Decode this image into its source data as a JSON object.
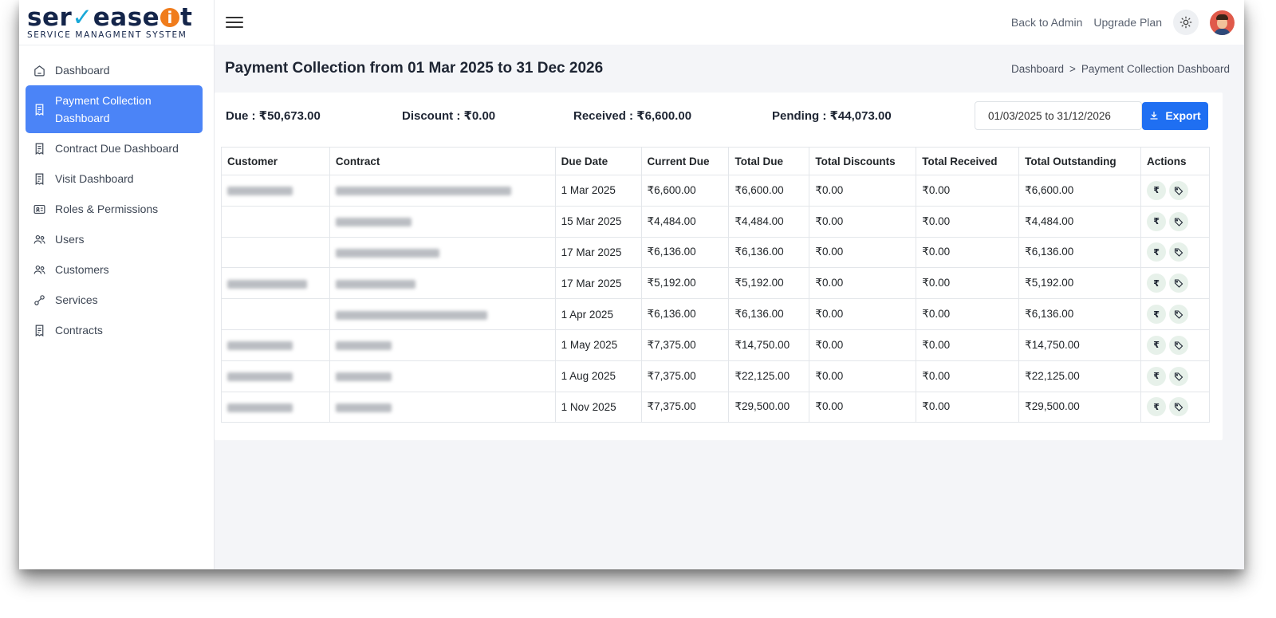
{
  "brand": {
    "logo_wordmark": "serveaseit",
    "tagline": "SERVICE MANAGMENT SYSTEM"
  },
  "sidebar": {
    "items": [
      {
        "label": "Dashboard",
        "icon": "home-icon",
        "active": false
      },
      {
        "label": "Payment Collection Dashboard",
        "icon": "receipt-icon",
        "active": true
      },
      {
        "label": "Contract Due Dashboard",
        "icon": "receipt-icon",
        "active": false
      },
      {
        "label": "Visit Dashboard",
        "icon": "receipt-icon",
        "active": false
      },
      {
        "label": "Roles & Permissions",
        "icon": "id-card-icon",
        "active": false
      },
      {
        "label": "Users",
        "icon": "users-icon",
        "active": false
      },
      {
        "label": "Customers",
        "icon": "users-icon",
        "active": false
      },
      {
        "label": "Services",
        "icon": "link-icon",
        "active": false
      },
      {
        "label": "Contracts",
        "icon": "receipt-icon",
        "active": false
      }
    ]
  },
  "topbar": {
    "back_to_admin": "Back to Admin",
    "upgrade_plan": "Upgrade Plan"
  },
  "header": {
    "title": "Payment Collection from 01 Mar 2025 to 31 Dec 2026",
    "breadcrumb": [
      "Dashboard",
      ">",
      "Payment Collection Dashboard"
    ]
  },
  "summary": {
    "due": "Due : ₹50,673.00",
    "discount": "Discount : ₹0.00",
    "received": "Received : ₹6,600.00",
    "pending": "Pending : ₹44,073.00",
    "date_range": "01/03/2025 to 31/12/2026",
    "export_label": "Export"
  },
  "table": {
    "columns": [
      "Customer",
      "Contract",
      "Due Date",
      "Current Due",
      "Total Due",
      "Total Discounts",
      "Total Received",
      "Total Outstanding",
      "Actions"
    ],
    "rows": [
      {
        "due_date": "1 Mar 2025",
        "current_due": "₹6,600.00",
        "total_due": "₹6,600.00",
        "total_discounts": "₹0.00",
        "total_received": "₹0.00",
        "total_outstanding": "₹6,600.00"
      },
      {
        "due_date": "15 Mar 2025",
        "current_due": "₹4,484.00",
        "total_due": "₹4,484.00",
        "total_discounts": "₹0.00",
        "total_received": "₹0.00",
        "total_outstanding": "₹4,484.00"
      },
      {
        "due_date": "17 Mar 2025",
        "current_due": "₹6,136.00",
        "total_due": "₹6,136.00",
        "total_discounts": "₹0.00",
        "total_received": "₹0.00",
        "total_outstanding": "₹6,136.00"
      },
      {
        "due_date": "17 Mar 2025",
        "current_due": "₹5,192.00",
        "total_due": "₹5,192.00",
        "total_discounts": "₹0.00",
        "total_received": "₹0.00",
        "total_outstanding": "₹5,192.00"
      },
      {
        "due_date": "1 Apr 2025",
        "current_due": "₹6,136.00",
        "total_due": "₹6,136.00",
        "total_discounts": "₹0.00",
        "total_received": "₹0.00",
        "total_outstanding": "₹6,136.00"
      },
      {
        "due_date": "1 May 2025",
        "current_due": "₹7,375.00",
        "total_due": "₹14,750.00",
        "total_discounts": "₹0.00",
        "total_received": "₹0.00",
        "total_outstanding": "₹14,750.00"
      },
      {
        "due_date": "1 Aug 2025",
        "current_due": "₹7,375.00",
        "total_due": "₹22,125.00",
        "total_discounts": "₹0.00",
        "total_received": "₹0.00",
        "total_outstanding": "₹22,125.00"
      },
      {
        "due_date": "1 Nov 2025",
        "current_due": "₹7,375.00",
        "total_due": "₹29,500.00",
        "total_discounts": "₹0.00",
        "total_received": "₹0.00",
        "total_outstanding": "₹29,500.00"
      }
    ],
    "action_icons": [
      "rupee-icon",
      "tag-icon"
    ],
    "rupee_glyph": "₹"
  },
  "colors": {
    "accent": "#4b84f7",
    "export_button": "#1f6ff2",
    "logo_navy": "#14254a",
    "logo_orange": "#f07c1c",
    "action_bg": "#e7f1ea"
  }
}
